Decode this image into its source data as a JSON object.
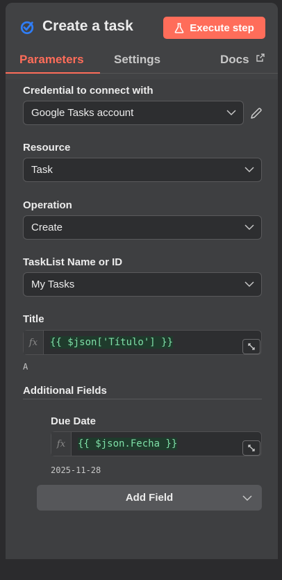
{
  "header": {
    "title": "Create a task",
    "execute_label": "Execute step"
  },
  "tabs": [
    {
      "label": "Parameters",
      "active": true
    },
    {
      "label": "Settings",
      "active": false
    },
    {
      "label": "Docs",
      "active": false
    }
  ],
  "fields": {
    "credential": {
      "label": "Credential to connect with",
      "value": "Google Tasks account"
    },
    "resource": {
      "label": "Resource",
      "value": "Task"
    },
    "operation": {
      "label": "Operation",
      "value": "Create"
    },
    "tasklist": {
      "label": "TaskList Name or ID",
      "value": "My Tasks"
    },
    "title": {
      "label": "Title",
      "expression": "{{ $json['Título'] }}",
      "result": "A"
    }
  },
  "additional": {
    "label": "Additional Fields",
    "due_date": {
      "label": "Due Date",
      "expression": "{{ $json.Fecha }}",
      "result": "2025-11-28"
    },
    "add_field_label": "Add Field"
  },
  "colors": {
    "accent": "#ff6d5a",
    "expression_text": "#7fe0a8",
    "icon_blue": "#2f7df6"
  },
  "icons": {
    "node": "google-tasks-icon",
    "execute": "flask-icon",
    "docs": "external-link-icon",
    "edit": "pencil-icon",
    "dropdown": "chevron-down-icon",
    "expand": "expand-icon"
  }
}
